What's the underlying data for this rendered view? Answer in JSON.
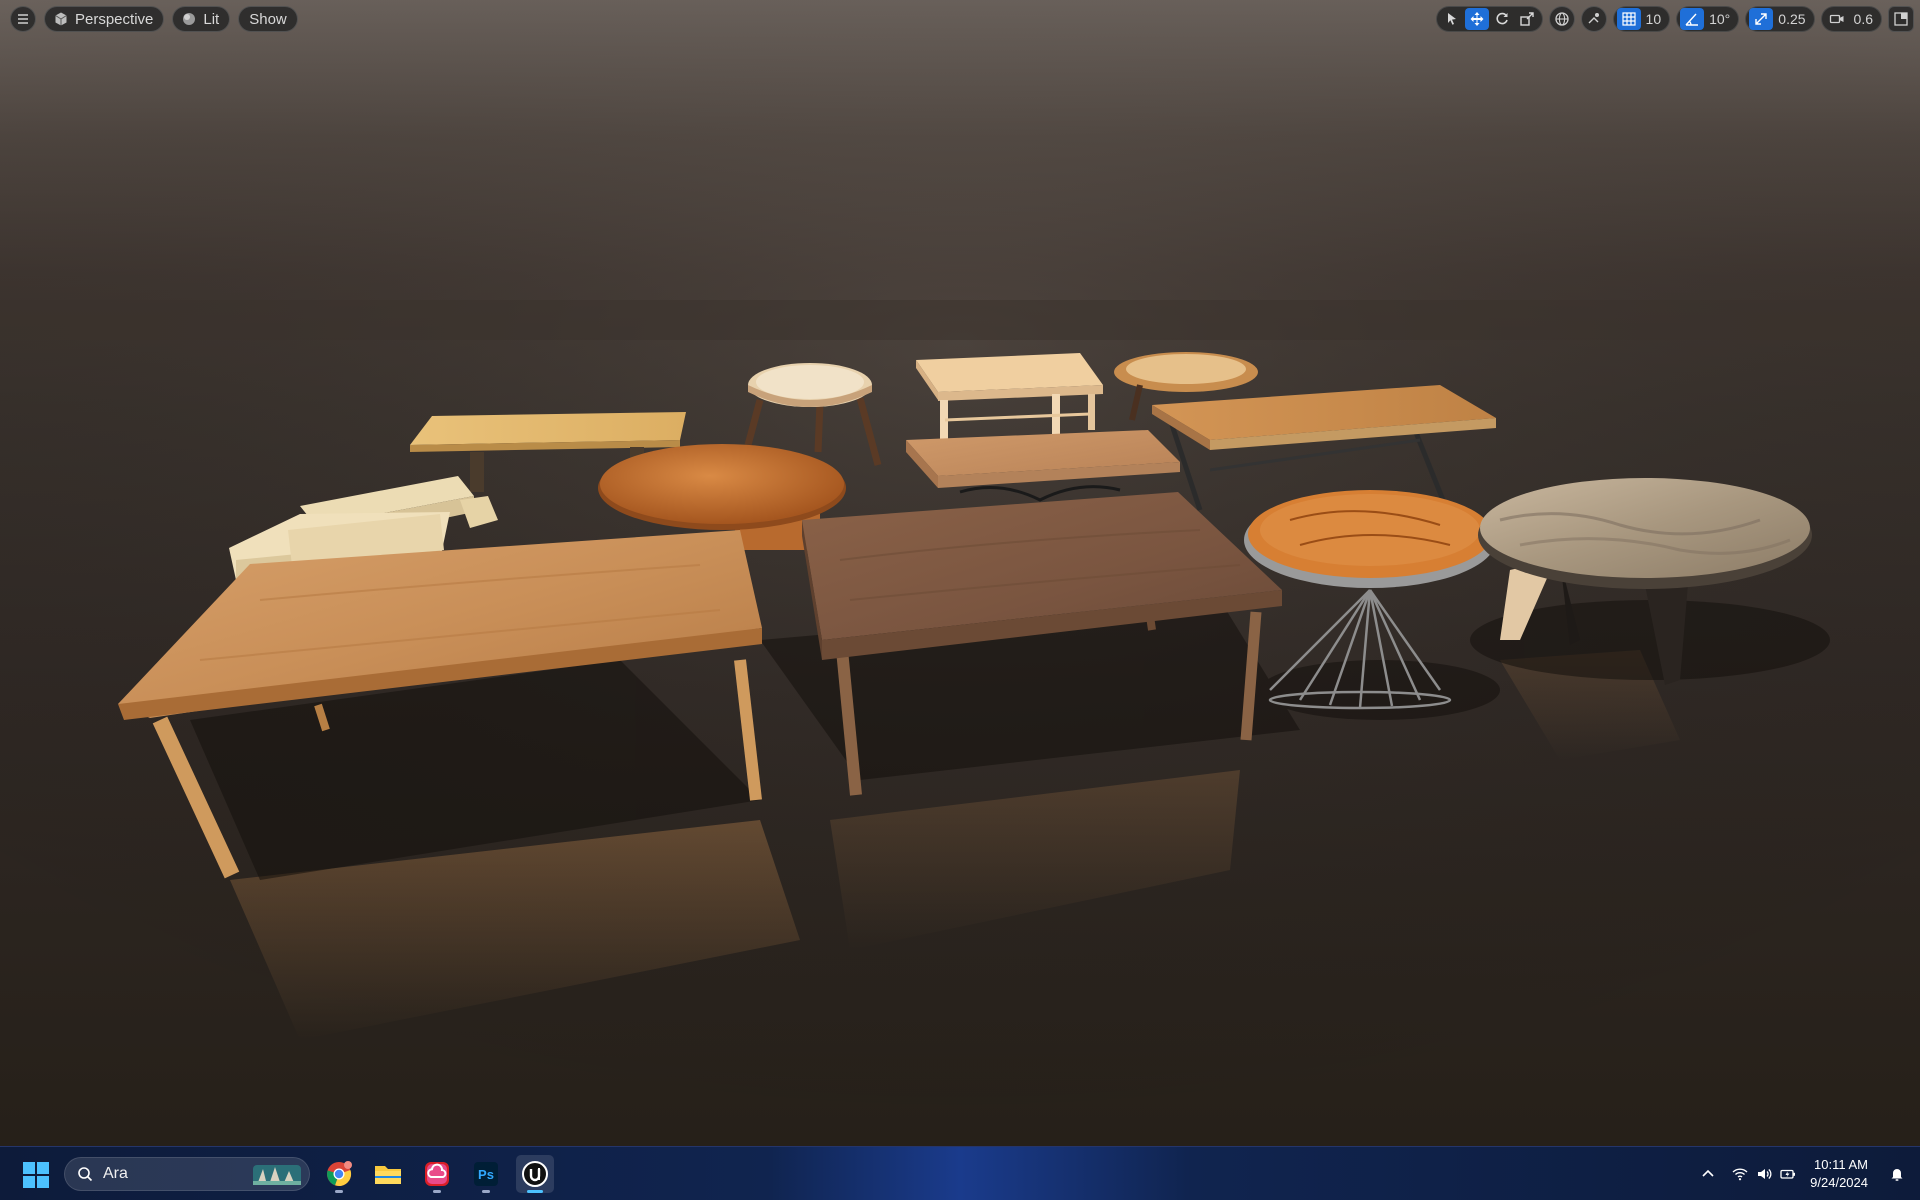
{
  "toolbar": {
    "view_mode": "Perspective",
    "lighting": "Lit",
    "show": "Show",
    "grid_snap": "10",
    "rotation_snap": "10°",
    "scale_snap": "0.25",
    "camera_speed": "0.6"
  },
  "taskbar": {
    "search_text": "Ara",
    "apps": [
      "Chrome",
      "File Explorer",
      "Creative Cloud",
      "Photoshop",
      "Unreal Engine"
    ],
    "time": "10:11 AM",
    "date": "9/24/2024"
  },
  "colors": {
    "accent": "#1f6fd8",
    "taskbar_highlight": "#4cc2ff",
    "floor": "#2f2824"
  }
}
